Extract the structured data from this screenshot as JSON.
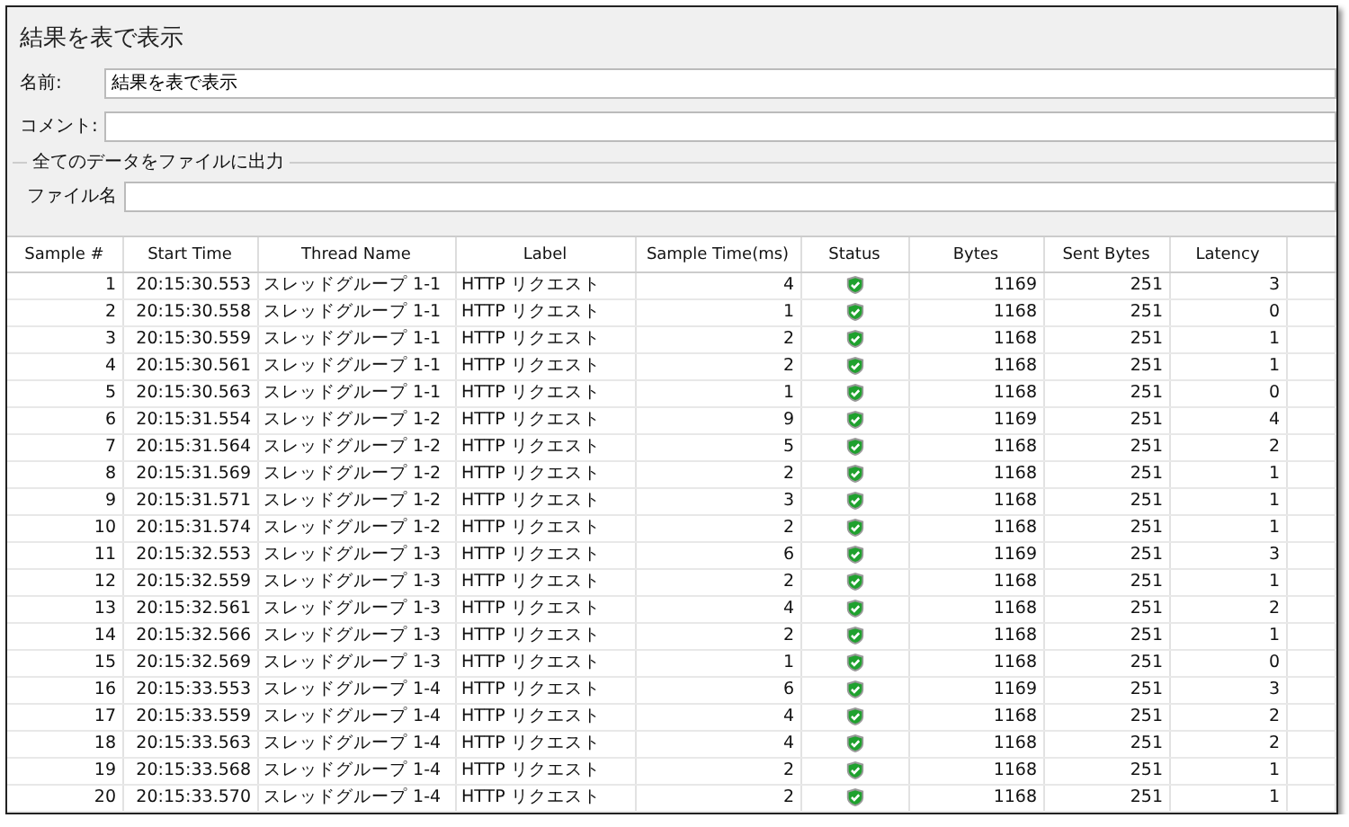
{
  "panel": {
    "title": "結果を表で表示",
    "name_label": "名前:",
    "name_value": "結果を表で表示",
    "comment_label": "コメント:",
    "output_group": "全てのデータをファイルに出力",
    "file_label": "ファイル名"
  },
  "table": {
    "columns": [
      "Sample #",
      "Start Time",
      "Thread Name",
      "Label",
      "Sample Time(ms)",
      "Status",
      "Bytes",
      "Sent Bytes",
      "Latency"
    ],
    "rows": [
      {
        "sample": "1",
        "start": "20:15:30.553",
        "thread": "スレッドグループ 1-1",
        "label": "HTTP リクエスト",
        "time": "4",
        "success": true,
        "bytes": "1169",
        "sent": "251",
        "latency": "3"
      },
      {
        "sample": "2",
        "start": "20:15:30.558",
        "thread": "スレッドグループ 1-1",
        "label": "HTTP リクエスト",
        "time": "1",
        "success": true,
        "bytes": "1168",
        "sent": "251",
        "latency": "0"
      },
      {
        "sample": "3",
        "start": "20:15:30.559",
        "thread": "スレッドグループ 1-1",
        "label": "HTTP リクエスト",
        "time": "2",
        "success": true,
        "bytes": "1168",
        "sent": "251",
        "latency": "1"
      },
      {
        "sample": "4",
        "start": "20:15:30.561",
        "thread": "スレッドグループ 1-1",
        "label": "HTTP リクエスト",
        "time": "2",
        "success": true,
        "bytes": "1168",
        "sent": "251",
        "latency": "1"
      },
      {
        "sample": "5",
        "start": "20:15:30.563",
        "thread": "スレッドグループ 1-1",
        "label": "HTTP リクエスト",
        "time": "1",
        "success": true,
        "bytes": "1168",
        "sent": "251",
        "latency": "0"
      },
      {
        "sample": "6",
        "start": "20:15:31.554",
        "thread": "スレッドグループ 1-2",
        "label": "HTTP リクエスト",
        "time": "9",
        "success": true,
        "bytes": "1169",
        "sent": "251",
        "latency": "4"
      },
      {
        "sample": "7",
        "start": "20:15:31.564",
        "thread": "スレッドグループ 1-2",
        "label": "HTTP リクエスト",
        "time": "5",
        "success": true,
        "bytes": "1168",
        "sent": "251",
        "latency": "2"
      },
      {
        "sample": "8",
        "start": "20:15:31.569",
        "thread": "スレッドグループ 1-2",
        "label": "HTTP リクエスト",
        "time": "2",
        "success": true,
        "bytes": "1168",
        "sent": "251",
        "latency": "1"
      },
      {
        "sample": "9",
        "start": "20:15:31.571",
        "thread": "スレッドグループ 1-2",
        "label": "HTTP リクエスト",
        "time": "3",
        "success": true,
        "bytes": "1168",
        "sent": "251",
        "latency": "1"
      },
      {
        "sample": "10",
        "start": "20:15:31.574",
        "thread": "スレッドグループ 1-2",
        "label": "HTTP リクエスト",
        "time": "2",
        "success": true,
        "bytes": "1168",
        "sent": "251",
        "latency": "1"
      },
      {
        "sample": "11",
        "start": "20:15:32.553",
        "thread": "スレッドグループ 1-3",
        "label": "HTTP リクエスト",
        "time": "6",
        "success": true,
        "bytes": "1169",
        "sent": "251",
        "latency": "3"
      },
      {
        "sample": "12",
        "start": "20:15:32.559",
        "thread": "スレッドグループ 1-3",
        "label": "HTTP リクエスト",
        "time": "2",
        "success": true,
        "bytes": "1168",
        "sent": "251",
        "latency": "1"
      },
      {
        "sample": "13",
        "start": "20:15:32.561",
        "thread": "スレッドグループ 1-3",
        "label": "HTTP リクエスト",
        "time": "4",
        "success": true,
        "bytes": "1168",
        "sent": "251",
        "latency": "2"
      },
      {
        "sample": "14",
        "start": "20:15:32.566",
        "thread": "スレッドグループ 1-3",
        "label": "HTTP リクエスト",
        "time": "2",
        "success": true,
        "bytes": "1168",
        "sent": "251",
        "latency": "1"
      },
      {
        "sample": "15",
        "start": "20:15:32.569",
        "thread": "スレッドグループ 1-3",
        "label": "HTTP リクエスト",
        "time": "1",
        "success": true,
        "bytes": "1168",
        "sent": "251",
        "latency": "0"
      },
      {
        "sample": "16",
        "start": "20:15:33.553",
        "thread": "スレッドグループ 1-4",
        "label": "HTTP リクエスト",
        "time": "6",
        "success": true,
        "bytes": "1169",
        "sent": "251",
        "latency": "3"
      },
      {
        "sample": "17",
        "start": "20:15:33.559",
        "thread": "スレッドグループ 1-4",
        "label": "HTTP リクエスト",
        "time": "4",
        "success": true,
        "bytes": "1168",
        "sent": "251",
        "latency": "2"
      },
      {
        "sample": "18",
        "start": "20:15:33.563",
        "thread": "スレッドグループ 1-4",
        "label": "HTTP リクエスト",
        "time": "4",
        "success": true,
        "bytes": "1168",
        "sent": "251",
        "latency": "2"
      },
      {
        "sample": "19",
        "start": "20:15:33.568",
        "thread": "スレッドグループ 1-4",
        "label": "HTTP リクエスト",
        "time": "2",
        "success": true,
        "bytes": "1168",
        "sent": "251",
        "latency": "1"
      },
      {
        "sample": "20",
        "start": "20:15:33.570",
        "thread": "スレッドグループ 1-4",
        "label": "HTTP リクエスト",
        "time": "2",
        "success": true,
        "bytes": "1168",
        "sent": "251",
        "latency": "1"
      }
    ]
  }
}
